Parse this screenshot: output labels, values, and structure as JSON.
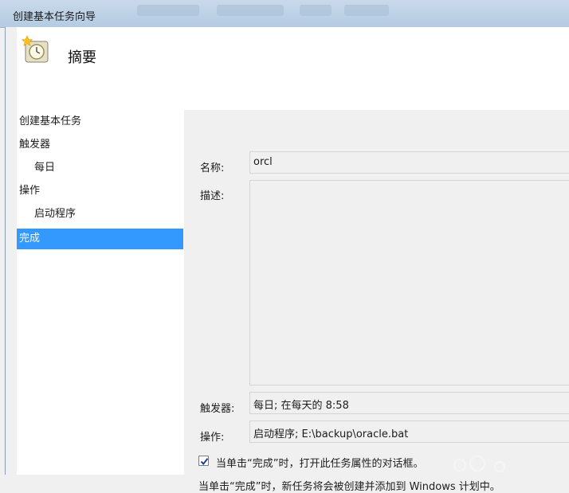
{
  "window": {
    "title": "创建基本任务向导"
  },
  "header": {
    "heading": "摘要",
    "icon": "clock-wizard-icon"
  },
  "nav": {
    "items": [
      {
        "label": "创建基本任务",
        "level": 0,
        "selected": false
      },
      {
        "label": "触发器",
        "level": 0,
        "selected": false
      },
      {
        "label": "每日",
        "level": 1,
        "selected": false
      },
      {
        "label": "操作",
        "level": 0,
        "selected": false
      },
      {
        "label": "启动程序",
        "level": 1,
        "selected": false
      },
      {
        "label": "完成",
        "level": 0,
        "selected": true
      }
    ]
  },
  "summary": {
    "name_label": "名称:",
    "name_value": "orcl",
    "desc_label": "描述:",
    "desc_value": "",
    "trigger_label": "触发器:",
    "trigger_value": "每日; 在每天的 8:58",
    "action_label": "操作:",
    "action_value": "启动程序; E:\\backup\\oracle.bat",
    "open_props_checkbox_label": "当单击“完成”时，打开此任务属性的对话框。",
    "open_props_checked": true,
    "finish_note": "当单击“完成”时，新任务将会被创建并添加到 Windows 计划中。"
  },
  "colors": {
    "selection": "#3399ff",
    "titlebar": "#b4cbe2"
  }
}
